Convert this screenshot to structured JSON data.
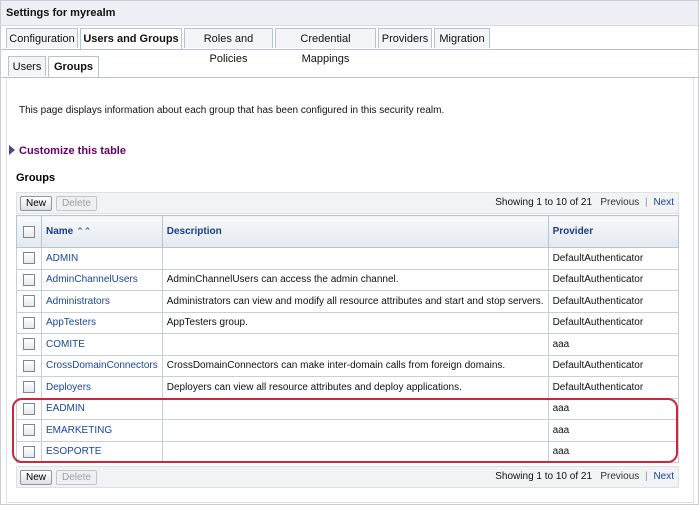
{
  "window": {
    "title": "Settings for myrealm"
  },
  "tabs": [
    {
      "label": "Configuration",
      "active": false
    },
    {
      "label": "Users and Groups",
      "active": true
    },
    {
      "label": "Roles and Policies",
      "active": false
    },
    {
      "label": "Credential Mappings",
      "active": false
    },
    {
      "label": "Providers",
      "active": false
    },
    {
      "label": "Migration",
      "active": false
    }
  ],
  "subtabs": [
    {
      "label": "Users",
      "active": false
    },
    {
      "label": "Groups",
      "active": true
    }
  ],
  "page": {
    "description": "This page displays information about each group that has been configured in this security realm.",
    "customize_label": "Customize this table",
    "section_title": "Groups"
  },
  "toolbar": {
    "new_label": "New",
    "delete_label": "Delete",
    "showing": "Showing 1 to 10 of 21",
    "previous_label": "Previous",
    "separator": "|",
    "next_label": "Next"
  },
  "table": {
    "columns": [
      "Name",
      "Description",
      "Provider"
    ],
    "rows": [
      {
        "name": "ADMIN",
        "description": "",
        "provider": "DefaultAuthenticator"
      },
      {
        "name": "AdminChannelUsers",
        "description": "AdminChannelUsers can access the admin channel.",
        "provider": "DefaultAuthenticator"
      },
      {
        "name": "Administrators",
        "description": "Administrators can view and modify all resource attributes and start and stop servers.",
        "provider": "DefaultAuthenticator"
      },
      {
        "name": "AppTesters",
        "description": "AppTesters group.",
        "provider": "DefaultAuthenticator"
      },
      {
        "name": "COMITE",
        "description": "",
        "provider": "aaa"
      },
      {
        "name": "CrossDomainConnectors",
        "description": "CrossDomainConnectors can make inter-domain calls from foreign domains.",
        "provider": "DefaultAuthenticator"
      },
      {
        "name": "Deployers",
        "description": "Deployers can view all resource attributes and deploy applications.",
        "provider": "DefaultAuthenticator"
      },
      {
        "name": "EADMIN",
        "description": "",
        "provider": "aaa"
      },
      {
        "name": "EMARKETING",
        "description": "",
        "provider": "aaa"
      },
      {
        "name": "ESOPORTE",
        "description": "",
        "provider": "aaa"
      }
    ]
  },
  "colors": {
    "highlight": "#c92a3b",
    "link": "#1a47a0",
    "header_text": "#1b3c8a",
    "customize": "#660066"
  }
}
